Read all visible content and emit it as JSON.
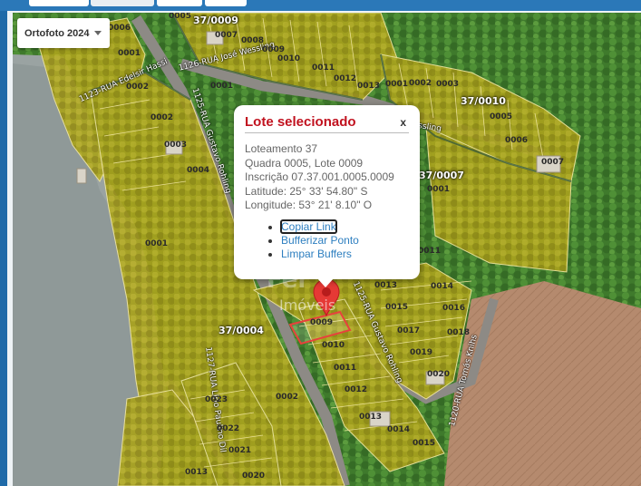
{
  "layer_select": {
    "label": "Ortofoto 2024"
  },
  "popup": {
    "title": "Lote selecionado",
    "close": "x",
    "lines": [
      "Loteamento 37",
      "Quadra 0005, Lote 0009",
      "Inscrição 07.37.001.0005.0009",
      "Latitude: 25° 33' 54.80\" S",
      "Longitude: 53° 21' 8.10\" O"
    ],
    "links": [
      "Copiar Link",
      "Bufferizar Ponto",
      "Limpar Buffers"
    ]
  },
  "watermark": {
    "brand": "Fer",
    "sub": "Imóveis"
  },
  "blocks": [
    "37/0009",
    "37/0010",
    "37/0007",
    "37/0004"
  ],
  "streets": [
    "1123-RUA Edelsir Hassi",
    "1126-RUA José Wessling",
    "1125-RUA Gustavo Rohling",
    "1125-RUA Gustavo Rohling",
    "1127-RUA Lírio Paulino Dil",
    "1120-RUA Tomás Knihs",
    "ssling"
  ],
  "lots": [
    "0005",
    "0006",
    "0007",
    "0008",
    "0009",
    "0010",
    "0011",
    "0012",
    "0013",
    "0001",
    "0002",
    "0003",
    "0005",
    "0006",
    "0007",
    "0001",
    "0002",
    "0003",
    "0004",
    "0001",
    "0002",
    "0001",
    "0001",
    "0013",
    "0014",
    "0015",
    "0016",
    "0017",
    "0018",
    "0019",
    "0020",
    "0009",
    "0010",
    "0011",
    "0012",
    "0013",
    "0014",
    "0015",
    "0002",
    "0023",
    "0022",
    "0021",
    "0020",
    "0013",
    "0011"
  ],
  "colors": {
    "parcel_fill": "#d4b41c",
    "parcel_line": "#f0e6a0",
    "selected_outline": "#e8413c",
    "popup_title": "#c1121f",
    "link": "#2e7fc0"
  }
}
